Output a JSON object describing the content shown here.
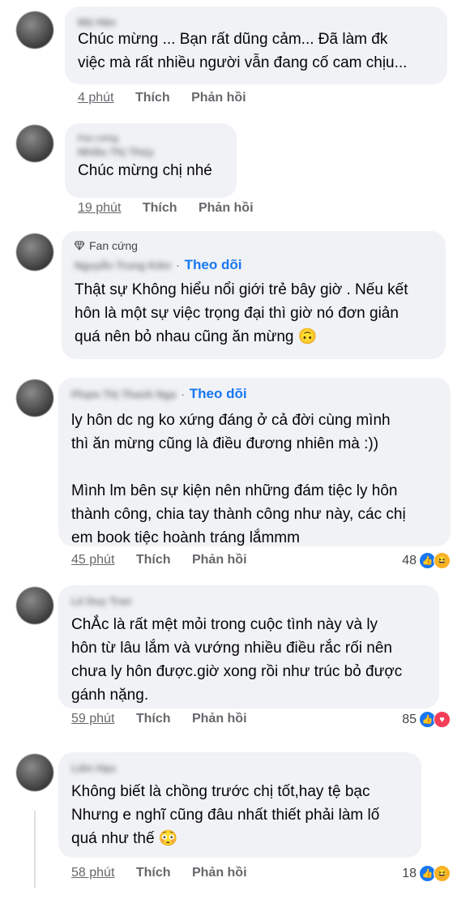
{
  "comments": [
    {
      "name": "Mộ Hân",
      "lines": [
        "Chúc mừng ... Bạn rất dũng cảm... Đã làm đk",
        "việc mà rất nhiều người vẫn đang cố cam chịu..."
      ],
      "time": "4 phút",
      "like": "Thích",
      "reply": "Phản hồi"
    },
    {
      "badge_blur": "Fan cứng",
      "name": "Nhiều Thị Thùy",
      "lines": [
        "Chúc mừng chị nhé"
      ],
      "time": "19 phút",
      "like": "Thích",
      "reply": "Phản hồi"
    },
    {
      "badge": "Fan cứng",
      "name": "Nguyễn Trung Kiên",
      "follow": "Theo dõi",
      "lines": [
        "Thật sự Không hiểu nổi giới trẻ bây giờ . Nếu kết",
        "hôn là một sự việc trọng đại thì giờ nó đơn giản",
        "quá nên bỏ nhau cũng ăn mừng 🙃"
      ]
    },
    {
      "name": "Phạm Thị Thanh Nga",
      "follow": "Theo dõi",
      "lines": [
        "ly hôn dc ng ko xứng đáng ở cả đời cùng mình",
        "thì ăn mừng cũng là điều đương nhiên mà :))",
        "",
        "Mình lm bên sự kiện nên những đám tiệc ly hôn",
        "thành công, chia tay thành công như này, các chị",
        "em book  tiệc hoành tráng lắmmm"
      ],
      "time": "45 phút",
      "like": "Thích",
      "reply": "Phản hồi",
      "reaction_count": "48",
      "reactions": [
        "like-icon",
        "haha-icon"
      ]
    },
    {
      "name": "Lê Duy Tran",
      "lines": [
        "ChẮc là rất mệt mỏi trong cuộc tình này và ly",
        "hôn từ lâu lắm và vướng nhiều điều rắc rối nên",
        "chưa ly hôn được.giờ xong rồi như trúc bỏ được",
        "gánh nặng."
      ],
      "time": "59 phút",
      "like": "Thích",
      "reply": "Phản hồi",
      "reaction_count": "85",
      "reactions": [
        "like-icon",
        "love-icon"
      ]
    },
    {
      "name": "Liên Hạo",
      "lines": [
        "Không biết là chồng trước chị tốt,hay tệ bạc",
        "Nhưng e nghĩ cũng đâu nhất thiết phải làm lố",
        "quá như thế 😳"
      ],
      "time": "58 phút",
      "like": "Thích",
      "reply": "Phản hồi",
      "reaction_count": "18",
      "reactions": [
        "like-icon",
        "haha-icon"
      ]
    }
  ],
  "colors": {
    "bubble": "#f0f2f5",
    "link": "#1877f2",
    "meta": "#65676b",
    "text": "#050505"
  }
}
